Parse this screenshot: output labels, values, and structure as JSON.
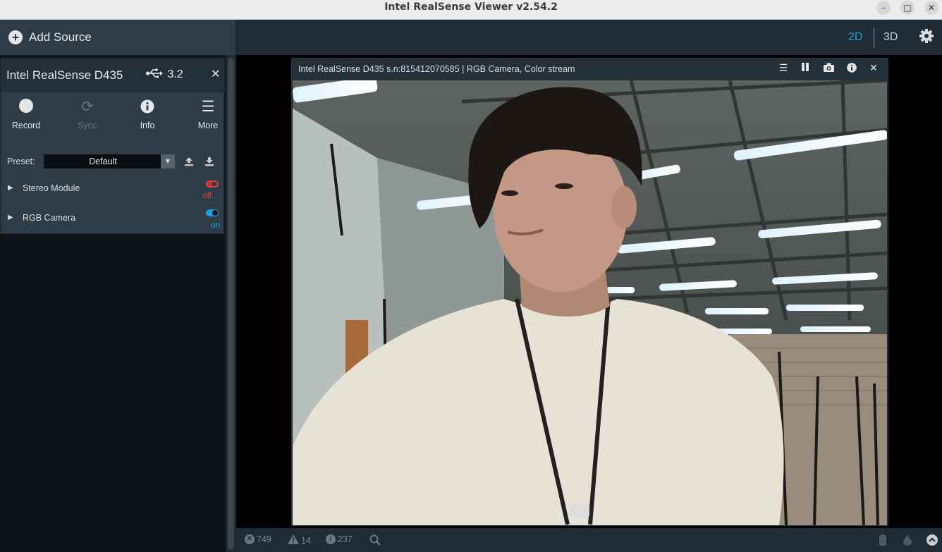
{
  "window": {
    "title": "Intel RealSense Viewer v2.54.2",
    "minimize_icon": "minimize-icon",
    "maximize_icon": "maximize-icon",
    "close_icon": "close-icon"
  },
  "toolbar": {
    "add_source_label": "Add Source",
    "view_2d_label": "2D",
    "view_3d_label": "3D",
    "active_view": "2D",
    "accent_color": "#1ea0e1"
  },
  "device": {
    "name": "Intel RealSense D435",
    "usb_version": "3.2",
    "buttons": [
      {
        "label": "Record",
        "icon": "record-icon",
        "enabled": true
      },
      {
        "label": "Sync",
        "icon": "sync-icon",
        "enabled": false
      },
      {
        "label": "Info",
        "icon": "info-icon",
        "enabled": true
      },
      {
        "label": "More",
        "icon": "menu-icon",
        "enabled": true
      }
    ],
    "preset_label": "Preset:",
    "preset_value": "Default",
    "modules": [
      {
        "name": "Stereo Module",
        "state": "off",
        "color": "#e53b3b"
      },
      {
        "name": "RGB Camera",
        "state": "on",
        "color": "#1ea0e1"
      }
    ]
  },
  "stream": {
    "title": "Intel RealSense D435 s.n:815412070585 | RGB Camera, Color stream",
    "icons": [
      "options-icon",
      "pause-icon",
      "camera-icon",
      "info-icon",
      "close-icon"
    ]
  },
  "status": {
    "errors": "749",
    "warnings": "14",
    "info": "237"
  }
}
